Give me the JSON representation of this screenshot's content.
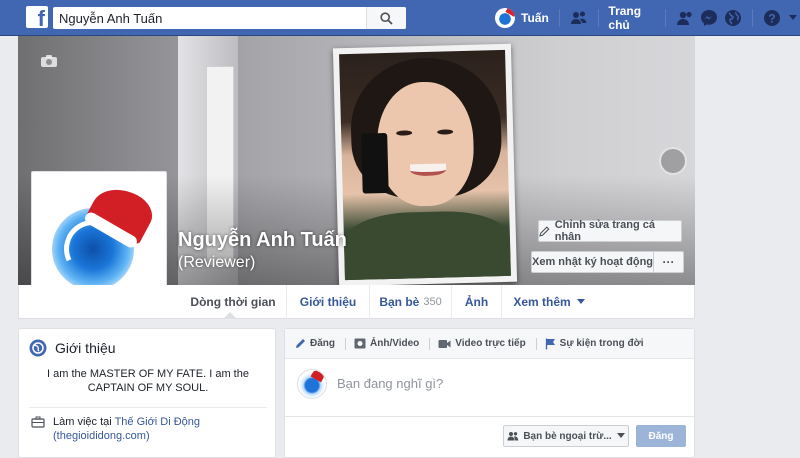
{
  "header": {
    "logo_letter": "f",
    "search_value": "Nguyễn Anh Tuấn",
    "user_name": "Tuấn",
    "home_label": "Trang chủ"
  },
  "profile": {
    "name": "Nguyễn Anh Tuấn",
    "alternate_name": "(Reviewer)",
    "edit_button": "Chỉnh sửa trang cá nhân",
    "activity_button": "Xem nhật ký hoạt động",
    "more_button": "···"
  },
  "tabs": [
    {
      "label": "Dòng thời gian"
    },
    {
      "label": "Giới thiệu"
    },
    {
      "label": "Bạn bè",
      "count": "350"
    },
    {
      "label": "Ảnh"
    },
    {
      "label": "Xem thêm"
    }
  ],
  "intro": {
    "title": "Giới thiệu",
    "bio": "I am the MASTER OF MY FATE. I am the CAPTAIN OF MY SOUL.",
    "work_prefix": "Làm việc tại",
    "work_link": "Thế Giới Di Động",
    "work_sub": "(thegioididong.com)"
  },
  "composer": {
    "tabs": [
      "Đăng",
      "Ảnh/Video",
      "Video trực tiếp",
      "Sự kiện trong đời"
    ],
    "placeholder": "Bạn đang nghĩ gì?",
    "audience": "Bạn bè ngoại trừ...",
    "post_button": "Đăng"
  },
  "colors": {
    "brand": "#4267b2",
    "link": "#365899",
    "post_button_disabled": "#9cb4d8"
  }
}
